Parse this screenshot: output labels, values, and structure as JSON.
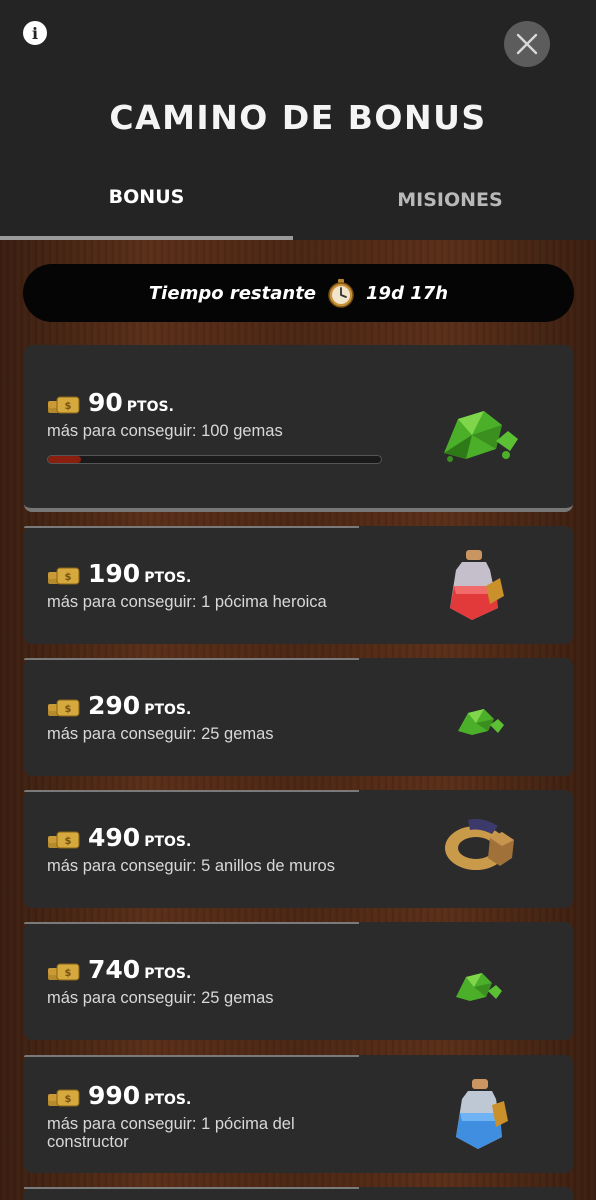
{
  "header": {
    "title": "CAMINO DE BONUS",
    "tabs": [
      {
        "label": "BONUS",
        "active": true
      },
      {
        "label": "MISIONES",
        "active": false
      }
    ]
  },
  "timer": {
    "label": "Tiempo restante",
    "value": "19d 17h",
    "icon": "stopwatch-icon"
  },
  "rewards": [
    {
      "points": "90",
      "unit": "PTOS.",
      "desc": "más para conseguir: 100 gemas",
      "icon": "gems-pile-icon",
      "progress": 0.1
    },
    {
      "points": "190",
      "unit": "PTOS.",
      "desc": "más para conseguir: 1 pócima heroica",
      "icon": "hero-potion-icon"
    },
    {
      "points": "290",
      "unit": "PTOS.",
      "desc": "más para conseguir: 25 gemas",
      "icon": "gems-icon"
    },
    {
      "points": "490",
      "unit": "PTOS.",
      "desc": "más para conseguir: 5 anillos de muros",
      "icon": "wall-ring-icon"
    },
    {
      "points": "740",
      "unit": "PTOS.",
      "desc": "más para conseguir: 25 gemas",
      "icon": "gems-icon"
    },
    {
      "points": "990",
      "unit": "PTOS.",
      "desc": "más para conseguir: 1 pócima del constructor",
      "icon": "builder-potion-icon"
    }
  ],
  "colors": {
    "background": "#242424",
    "card": "#2b2b2b",
    "progress_fill": "#8a1f10",
    "gem_green": "#4caf2a"
  }
}
